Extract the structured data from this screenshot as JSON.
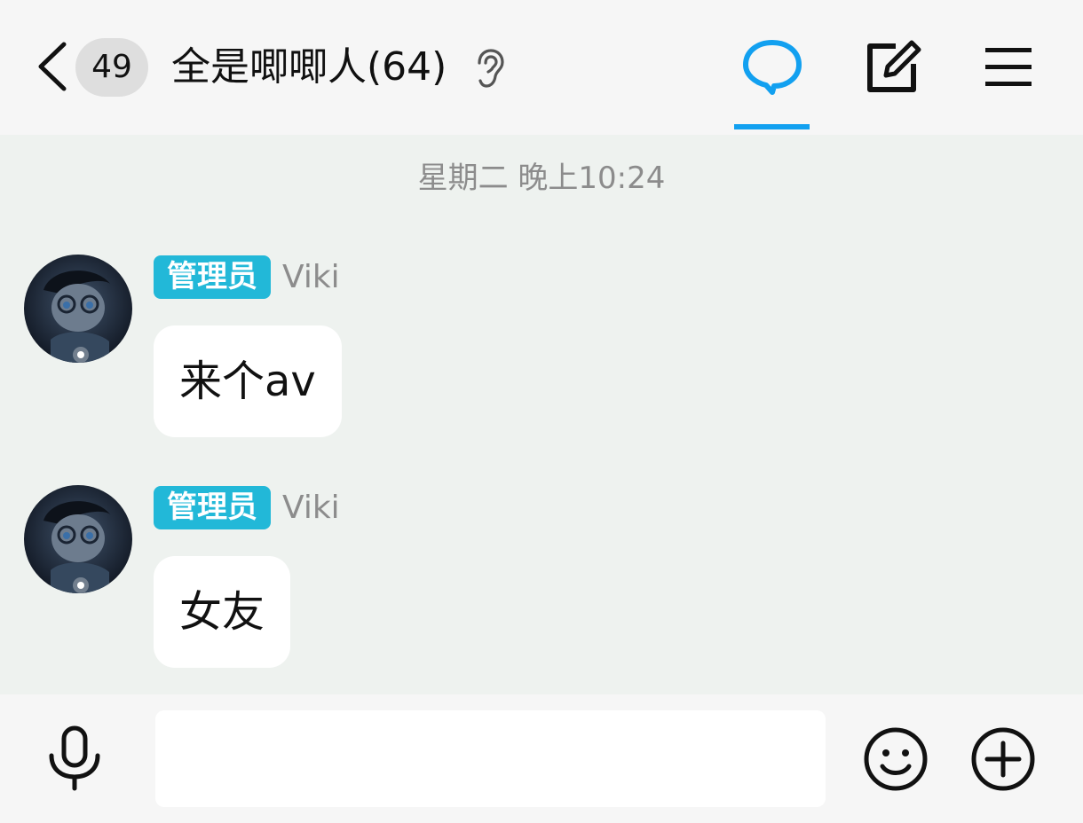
{
  "header": {
    "unread_count": "49",
    "title": "全是唧唧人(64)",
    "icons": [
      "back-icon",
      "ear-icon",
      "chat-icon",
      "edit-icon",
      "menu-icon"
    ],
    "accent_color": "#12a0f0"
  },
  "messages_area": {
    "timestamp": "星期二 晚上10:24",
    "messages": [
      {
        "role_badge": "管理员",
        "sender": "Viki",
        "text": "来个av"
      },
      {
        "role_badge": "管理员",
        "sender": "Viki",
        "text": "女友"
      }
    ]
  },
  "input_bar": {
    "message_value": "",
    "icons": [
      "microphone-icon",
      "emoji-icon",
      "plus-icon"
    ]
  },
  "colors": {
    "background": "#eef2ef",
    "header_bg": "#f6f6f6",
    "badge_bg": "#22b8d8",
    "bubble_bg": "#ffffff"
  }
}
